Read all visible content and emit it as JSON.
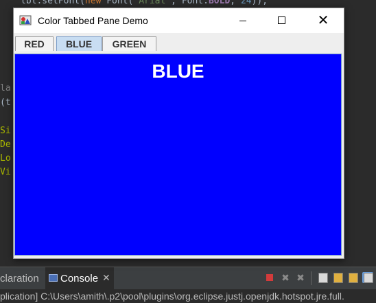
{
  "editor": {
    "line_top": [
      "lbl.setFont(",
      "new",
      " Font(",
      "\"Arial\"",
      ", Font.",
      "BOLD",
      ", ",
      "24",
      "));"
    ],
    "line_la": "la",
    "line_t": "(t",
    "line_si": "Si",
    "line_de": "De",
    "line_lo": "Lo",
    "line_vi": "Vi"
  },
  "console_bar": {
    "declaration_tab": "claration",
    "console_tab": "Console",
    "console_close": "✕",
    "tool_remove": "✖",
    "tool_removeall": "✖"
  },
  "status_line": "plication] C:\\Users\\amith\\.p2\\pool\\plugins\\org.eclipse.justj.openjdk.hotspot.jre.full.",
  "window": {
    "title": "Color Tabbed Pane Demo",
    "close_glyph": "✕",
    "tabs": [
      {
        "label": "RED"
      },
      {
        "label": "BLUE"
      },
      {
        "label": "GREEN"
      }
    ],
    "selected_tab": "BLUE",
    "panel_label": "BLUE",
    "panel_color": "#0000ff"
  }
}
